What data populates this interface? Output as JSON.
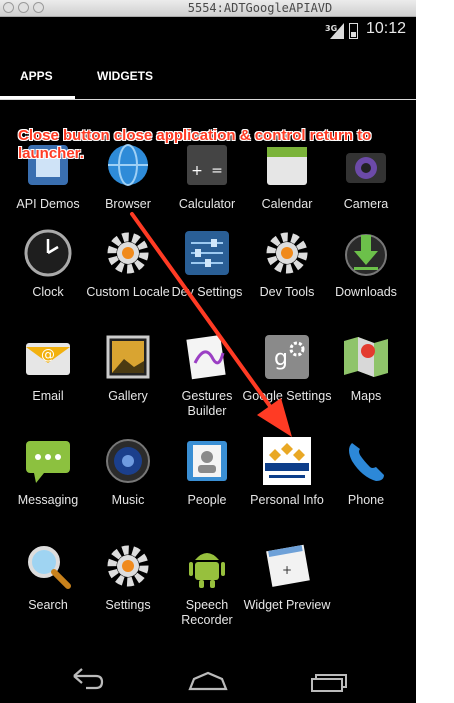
{
  "window": {
    "title": "5554:ADTGoogleAPIAVD"
  },
  "status_bar": {
    "network": "3G",
    "time": "10:12"
  },
  "tabs": [
    {
      "label": "APPS",
      "selected": true
    },
    {
      "label": "WIDGETS",
      "selected": false
    }
  ],
  "annotation": {
    "text": "Close button close application & control return to launcher.",
    "color": "#ff3b24"
  },
  "apps": [
    {
      "label": "API Demos",
      "icon": "api-demos-icon"
    },
    {
      "label": "Browser",
      "icon": "globe-icon"
    },
    {
      "label": "Calculator",
      "icon": "calculator-icon"
    },
    {
      "label": "Calendar",
      "icon": "calendar-icon"
    },
    {
      "label": "Camera",
      "icon": "camera-icon"
    },
    {
      "label": "Clock",
      "icon": "clock-icon"
    },
    {
      "label": "Custom Locale",
      "icon": "gear-icon"
    },
    {
      "label": "Dev Settings",
      "icon": "sliders-icon"
    },
    {
      "label": "Dev Tools",
      "icon": "gear-icon"
    },
    {
      "label": "Downloads",
      "icon": "download-icon"
    },
    {
      "label": "Email",
      "icon": "email-icon"
    },
    {
      "label": "Gallery",
      "icon": "gallery-icon"
    },
    {
      "label": "Gestures Builder",
      "icon": "gestures-icon"
    },
    {
      "label": "Google Settings",
      "icon": "google-plus-gear-icon"
    },
    {
      "label": "Maps",
      "icon": "map-icon"
    },
    {
      "label": "Messaging",
      "icon": "chat-bubble-icon"
    },
    {
      "label": "Music",
      "icon": "speaker-icon"
    },
    {
      "label": "People",
      "icon": "contacts-icon"
    },
    {
      "label": "Personal Info",
      "icon": "sjsu-logo-icon",
      "logo_text": "San José State UNIVERSITY"
    },
    {
      "label": "Phone",
      "icon": "phone-icon"
    },
    {
      "label": "Search",
      "icon": "magnifier-icon"
    },
    {
      "label": "Settings",
      "icon": "gear-icon"
    },
    {
      "label": "Speech Recorder",
      "icon": "android-icon"
    },
    {
      "label": "Widget Preview",
      "icon": "widget-preview-icon"
    }
  ],
  "nav": [
    {
      "name": "back",
      "icon": "back-arrow-icon"
    },
    {
      "name": "home",
      "icon": "home-icon"
    },
    {
      "name": "recent",
      "icon": "recent-apps-icon"
    }
  ]
}
